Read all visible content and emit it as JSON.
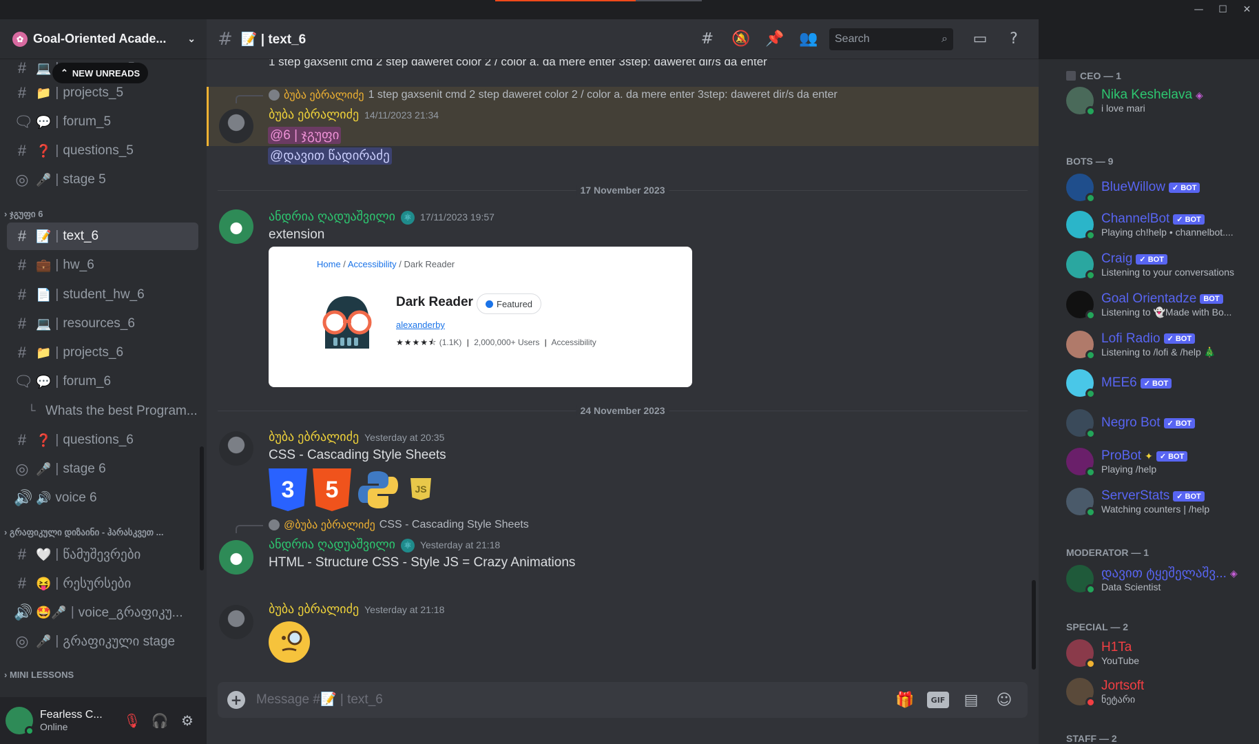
{
  "window": {
    "progress_pct": 68,
    "controls": [
      "—",
      "☐",
      "✕"
    ]
  },
  "guild": {
    "name": "Goal-Oriented Acade...",
    "new_unreads": "NEW UNREADS"
  },
  "channels": [
    {
      "icon": "#",
      "emoji": "💻",
      "name": "resources_5",
      "type": "text"
    },
    {
      "icon": "#",
      "emoji": "📁",
      "name": "projects_5",
      "type": "text"
    },
    {
      "icon": "🗨",
      "emoji": "💬",
      "name": "forum_5",
      "type": "forum"
    },
    {
      "icon": "#",
      "emoji": "❓",
      "name": "questions_5",
      "type": "text"
    },
    {
      "icon": "◎",
      "emoji": "🎤",
      "name": " stage 5",
      "type": "stage"
    }
  ],
  "category_6": "ჯგუფი 6",
  "channels_6": [
    {
      "icon": "#",
      "emoji": "📝",
      "name": "text_6",
      "active": true
    },
    {
      "icon": "#",
      "emoji": "💼",
      "name": "hw_6"
    },
    {
      "icon": "#",
      "emoji": "📄",
      "name": "student_hw_6"
    },
    {
      "icon": "#",
      "emoji": "💻",
      "name": "resources_6"
    },
    {
      "icon": "#",
      "emoji": "📁",
      "name": "projects_6"
    },
    {
      "icon": "🗨",
      "emoji": "💬",
      "name": "forum_6"
    },
    {
      "icon": "└",
      "emoji": "",
      "name": "Whats the best Program...",
      "thread": true
    },
    {
      "icon": "#",
      "emoji": "❓",
      "name": "questions_6"
    },
    {
      "icon": "◎",
      "emoji": "🎤",
      "name": " stage 6"
    },
    {
      "icon": "🔊",
      "emoji": "",
      "name": "voice 6"
    }
  ],
  "category_design": "გრაფიკული დიზაინი - ჰარასკვეთ ...",
  "channels_design": [
    {
      "icon": "#",
      "emoji": "🤍",
      "name": "წამუშევრები"
    },
    {
      "icon": "#",
      "emoji": "😝",
      "name": "რესურსები"
    },
    {
      "icon": "🔊",
      "emoji": "🤩🎤",
      "name": "voice_გრაფიკუ..."
    },
    {
      "icon": "◎",
      "emoji": "🎤",
      "name": "გრაფიკული stage"
    }
  ],
  "category_mini": "MINI LESSONS",
  "user": {
    "name": "Fearless C...",
    "status": "Online"
  },
  "header": {
    "channel": "text_6",
    "search_placeholder": "Search"
  },
  "messages": {
    "top_cut": "1 step gaxsenit cmd 2 step daweret color 2 / color a. da mere enter 3step: daweret dir/s da enter",
    "m1": {
      "reply_author": "ბუბა ებრალიძე",
      "reply_text": "1 step gaxsenit cmd 2 step daweret color 2 / color a. da mere enter 3step: daweret dir/s da enter",
      "author": "ბუბა ებრალიძე",
      "time": "14/11/2023 21:34",
      "role_ping": "@6 | ჯგუფი",
      "user_ping": "@დავით წადირაძე"
    },
    "divider1": "17 November 2023",
    "m2": {
      "author": "ანდრია ღადუაშვილი",
      "time": "17/11/2023 19:57",
      "text": "extension"
    },
    "embed": {
      "crumb_home": "Home",
      "crumb_sep1": " / ",
      "crumb_acc": "Accessibility",
      "crumb_sep2": " / Dark Reader",
      "title": "Dark Reader",
      "featured": "Featured",
      "author": "alexanderby",
      "stars": "★★★★⯪",
      "rating_count": "(1.1K)",
      "users": "2,000,000+ Users",
      "category": "Accessibility"
    },
    "divider2": "24 November 2023",
    "m3": {
      "author": "ბუბა ებრალიძე",
      "time": "Yesterday at 20:35",
      "text": "CSS - Cascading Style Sheets"
    },
    "m4": {
      "reply_author": "@ბუბა ებრალიძე",
      "reply_text": "CSS - Cascading Style Sheets",
      "author": "ანდრია ღადუაშვილი",
      "time": "Yesterday at 21:18",
      "text": "HTML - Structure CSS - Style JS = Crazy Animations"
    },
    "m5": {
      "author": "ბუბა ებრალიძე",
      "time": "Yesterday at 21:18"
    }
  },
  "composer": {
    "placeholder": "Message #📝 | text_6"
  },
  "member_groups": {
    "ceo": "CEO — 1",
    "bots": "BOTS — 9",
    "moderator": "MODERATOR — 1",
    "special": "SPECIAL — 2",
    "staff": "STAFF — 2"
  },
  "members": {
    "ceo": [
      {
        "name": "Nika Keshelava",
        "status": "i love mari",
        "color": "#2dc770"
      }
    ],
    "bots": [
      {
        "name": "BlueWillow",
        "status": ""
      },
      {
        "name": "ChannelBot",
        "status": "Playing ch!help • channelbot...."
      },
      {
        "name": "Craig",
        "status": "Listening to your conversations"
      },
      {
        "name": "Goal Orientadze",
        "status": "Listening to 👻Made with Bo..."
      },
      {
        "name": "Lofi Radio",
        "status": "Listening to /lofi & /help 🎄"
      },
      {
        "name": "MEE6",
        "status": ""
      },
      {
        "name": "Negro Bot",
        "status": ""
      },
      {
        "name": "ProBot",
        "status": "Playing /help"
      },
      {
        "name": "ServerStats",
        "status": "Watching counters | /help"
      }
    ],
    "moderator": [
      {
        "name": "დავით ტყეშელაშვ...",
        "status": "Data Scientist"
      }
    ],
    "special": [
      {
        "name": "H1Ta",
        "status": "YouTube",
        "color": "#f23f43"
      },
      {
        "name": "Jortsoft",
        "status": "ნეტარი",
        "color": "#f23f43"
      }
    ],
    "bot_tag": "BOT"
  }
}
